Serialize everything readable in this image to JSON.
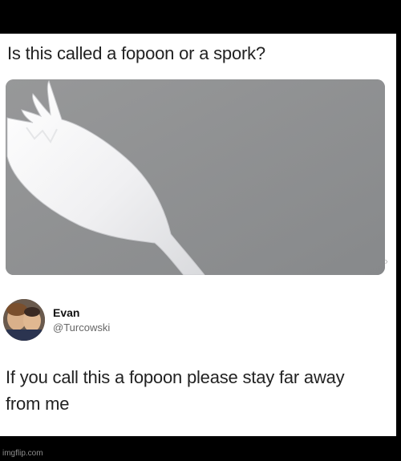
{
  "post": {
    "question": "Is this called a fopoon or a spork?"
  },
  "reply": {
    "name": "Evan",
    "handle": "@Turcowski",
    "text": "If you call this a fopoon please stay far away from me"
  },
  "watermark": "imgflip.com",
  "icons": {
    "scroll_nub": "›"
  }
}
